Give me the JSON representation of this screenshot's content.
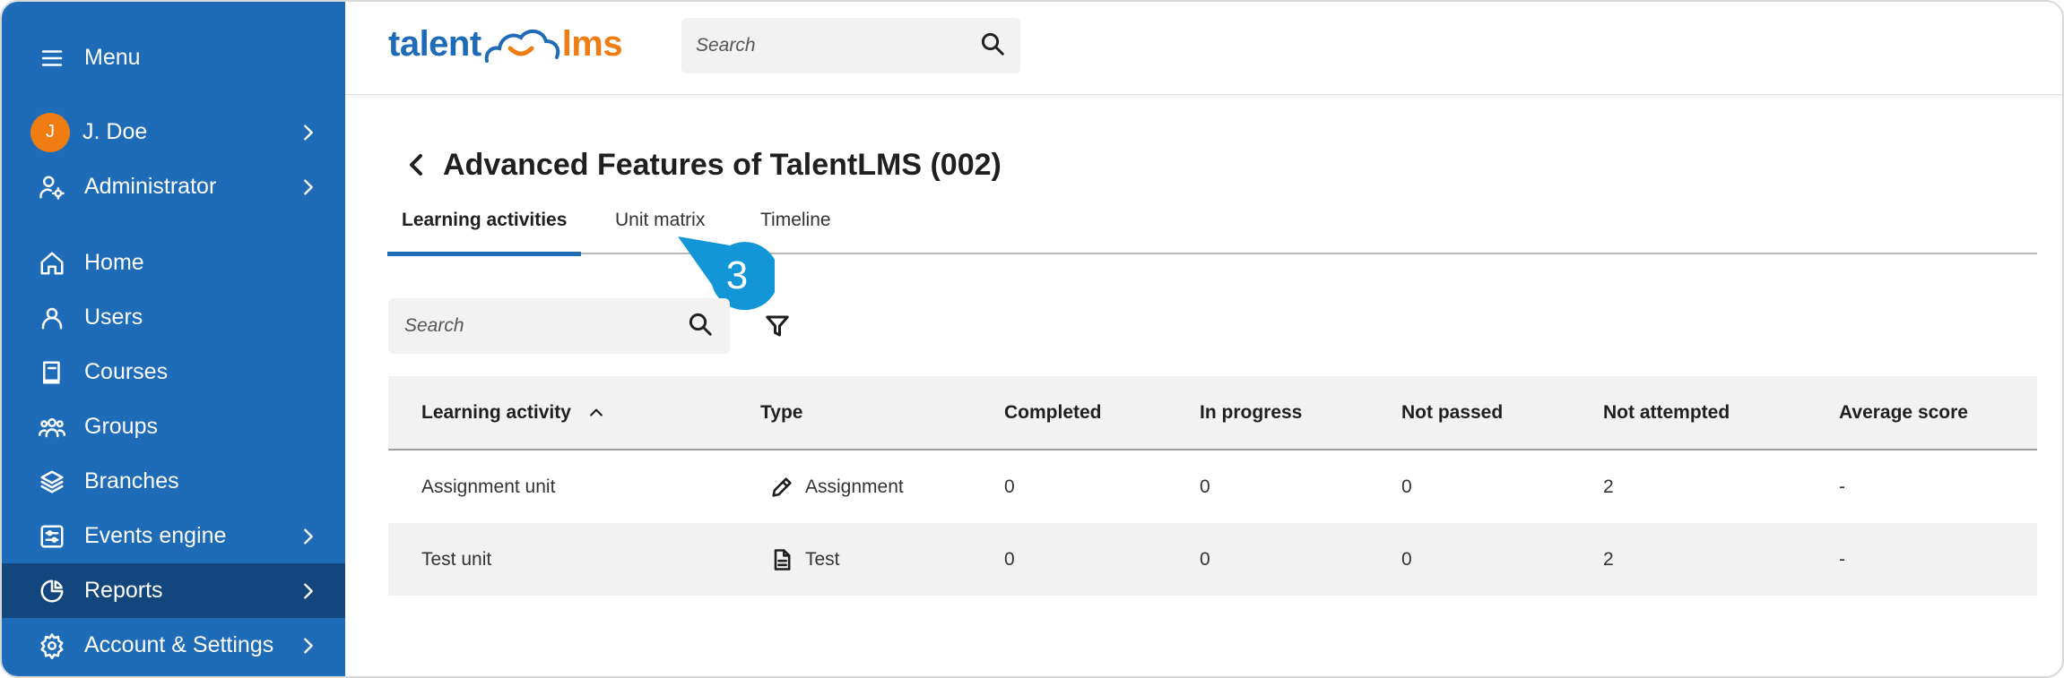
{
  "sidebar": {
    "menu_label": "Menu",
    "user_name": "J. Doe",
    "user_initial": "J",
    "role": "Administrator",
    "items": [
      {
        "label": "Home",
        "icon": "home-icon"
      },
      {
        "label": "Users",
        "icon": "user-icon"
      },
      {
        "label": "Courses",
        "icon": "book-icon"
      },
      {
        "label": "Groups",
        "icon": "group-icon"
      },
      {
        "label": "Branches",
        "icon": "layers-icon"
      },
      {
        "label": "Events engine",
        "icon": "events-icon"
      },
      {
        "label": "Reports",
        "icon": "pie-chart-icon"
      },
      {
        "label": "Account & Settings",
        "icon": "gear-icon"
      }
    ],
    "active_item": "Reports"
  },
  "header": {
    "logo_left": "talent",
    "logo_right": "lms",
    "search_placeholder": "Search"
  },
  "main": {
    "title": "Advanced Features of TalentLMS (002)",
    "tabs": [
      {
        "label": "Learning activities",
        "active": true
      },
      {
        "label": "Unit matrix",
        "active": false
      },
      {
        "label": "Timeline",
        "active": false
      }
    ],
    "callout_number": "3",
    "search_placeholder": "Search",
    "table": {
      "columns": [
        "Learning activity",
        "Type",
        "Completed",
        "In progress",
        "Not passed",
        "Not attempted",
        "Average score"
      ],
      "rows": [
        {
          "activity": "Assignment unit",
          "type": "Assignment",
          "type_icon": "pencil-icon",
          "completed": "0",
          "in_progress": "0",
          "not_passed": "0",
          "not_attempted": "2",
          "average_score": "-"
        },
        {
          "activity": "Test unit",
          "type": "Test",
          "type_icon": "document-icon",
          "completed": "0",
          "in_progress": "0",
          "not_passed": "0",
          "not_attempted": "2",
          "average_score": "-"
        }
      ]
    }
  },
  "colors": {
    "sidebar_bg": "#1e6bb8",
    "sidebar_active": "#12467d",
    "brand_blue": "#1e6bb8",
    "brand_orange": "#f07c14",
    "callout": "#1296d8"
  }
}
